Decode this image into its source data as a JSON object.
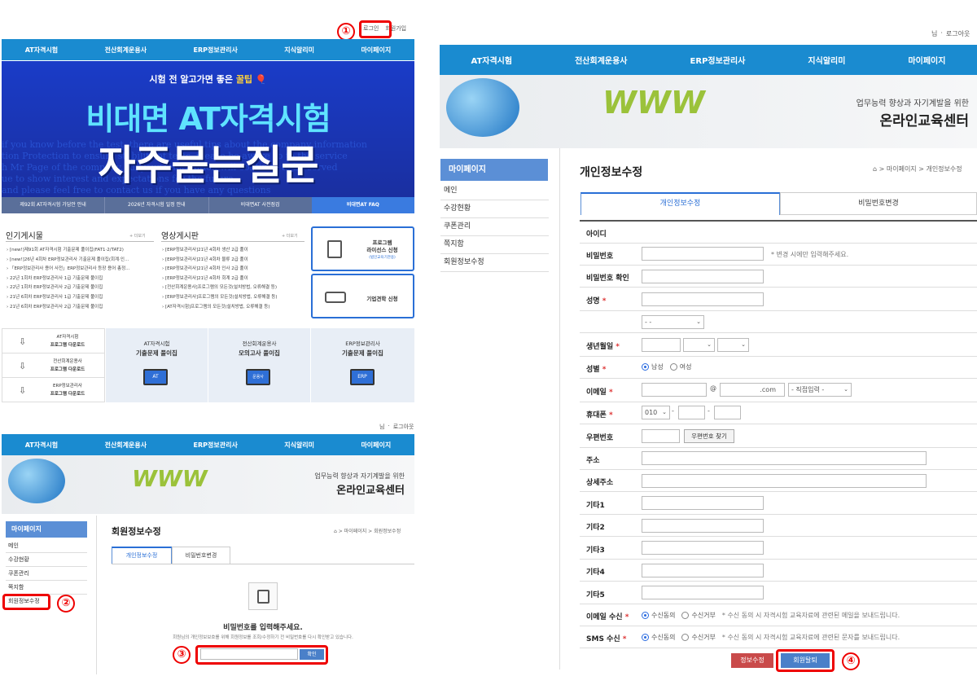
{
  "nav_items": [
    "AT자격시험",
    "전산회계운용사",
    "ERP정보관리사",
    "지식알리미",
    "마이페이지"
  ],
  "top_login": {
    "login": "로그인",
    "join": "회원가입"
  },
  "user_links": {
    "nim": "님",
    "logout": "로그아웃"
  },
  "step_numbers": [
    "①",
    "②",
    "③",
    "④"
  ],
  "banner": {
    "kicker": "시험 전 알고가면 좋은",
    "kicker_hl": "꿀팁",
    "title1": "비대면 AT자격시험",
    "title2": "자주묻는질문"
  },
  "banner_tabs": [
    "제92회 AT자격시험 가답안 안내",
    "2026년 자격시험 일정 안내",
    "비대면AT 사전점검",
    "비대면AT FAQ"
  ],
  "popular": {
    "title": "인기게시물",
    "more": "+ 더보기",
    "items": [
      "[new!]제91회 AT자격시험 기출문제 풀이집(FAT1·2/TAT2)",
      "[new!]26년 4회차 ERP정보관리사 기출문제 풀이집(회계·인...",
      "「ERP정보관리사 용어 사전」ERP정보관리사 등장 용어 총정...",
      "22년 1회차 ERP정보관리사 1급 기출문제 풀이집",
      "22년 1회차 ERP정보관리사 2급 기출문제 풀이집",
      "21년 6회차 ERP정보관리사 1급 기출문제 풀이집",
      "21년 6회차 ERP정보관리사 2급 기출문제 풀이집"
    ]
  },
  "video": {
    "title": "영상게시판",
    "more": "+ 더보기",
    "items": [
      "[ERP정보관리사]21년 4회차 생산 2급 풀이",
      "[ERP정보관리사]21년 4회차 물류 2급 풀이",
      "[ERP정보관리사]21년 4회차 인사 2급 풀이",
      "[ERP정보관리사]21년 4회차 회계 2급 풀이",
      "[전산회계운용사]프로그램의 모든것(설치방법, 오류해결 등)",
      "[ERP정보관리사]프로그램의 모든것(설치방법, 오류해결 등)",
      "[AT자격시험]프로그램의 모든것(설치방법, 오류해결 등)"
    ]
  },
  "side_cards": {
    "card1_title": "프로그램\n라이선스 신청",
    "card1_sub": "(법인교육기관용)",
    "card2_title": "기업견학 신청"
  },
  "downloads": [
    {
      "name": "AT자격시험",
      "label": "프로그램 다운로드"
    },
    {
      "name": "전산회계운용사",
      "label": "프로그램 다운로드"
    },
    {
      "name": "ERP정보관리사",
      "label": "프로그램 다운로드"
    }
  ],
  "books": [
    {
      "sub": "AT자격시험",
      "title": "기출문제 풀이집",
      "tag": "AT"
    },
    {
      "sub": "전산회계운용사",
      "title": "모의고사 풀이집",
      "tag": "운용사"
    },
    {
      "sub": "ERP정보관리사",
      "title": "기출문제 풀이집",
      "tag": "ERP"
    }
  ],
  "edu_banner": {
    "line1": "업무능력 향상과 자기계발을 위한",
    "line2": "온라인교육센터",
    "www": "WWW"
  },
  "mypage_side": {
    "title": "마이페이지",
    "items": [
      "메인",
      "수강현황",
      "쿠폰관리",
      "쪽지함",
      "회원정보수정"
    ]
  },
  "verify": {
    "page_title": "회원정보수정",
    "breadcrumb": "⌂ > 마이페이지 > 회원정보수정",
    "tabs": [
      "개인정보수정",
      "비밀번호변경"
    ],
    "heading": "비밀번호를 입력해주세요.",
    "desc": "회원님의 개인정보보호를 위해 회원정보를 조회/수정하기 전 비밀번호를 다시 확인받고 있습니다.",
    "confirm": "확인"
  },
  "form": {
    "page_title": "개인정보수정",
    "breadcrumb": "⌂ > 마이페이지 > 개인정보수정",
    "tabs": [
      "개인정보수정",
      "비밀번호변경"
    ],
    "labels": {
      "id": "아이디",
      "pw": "비밀번호",
      "pw_confirm": "비밀번호 확인",
      "name": "성명",
      "birth": "생년월일",
      "gender": "성별",
      "email": "이메일",
      "phone": "휴대폰",
      "zip": "우편번호",
      "addr": "주소",
      "addr2": "상세주소",
      "etc1": "기타1",
      "etc2": "기타2",
      "etc3": "기타3",
      "etc4": "기타4",
      "etc5": "기타5",
      "email_rcv": "이메일 수신",
      "sms_rcv": "SMS 수신"
    },
    "req_mark": "*",
    "pw_note": "* 변경 시에만 입력해주세요.",
    "select_blank": "- -",
    "gender_male": "남성",
    "gender_female": "여성",
    "at": "@",
    "email_domain": ".com",
    "email_select": "- 직접입력 -",
    "phone_prefix": "010",
    "dash": "-",
    "zip_button": "우편번호 찾기",
    "agree": "수신동의",
    "refuse": "수신거부",
    "email_note": "* 수신 동의 시 자격시험 교육자료에 관련된 메일을 보내드립니다.",
    "sms_note": "* 수신 동의 시 자격시험 교육자료에 관련된 문자를 보내드립니다.",
    "save": "정보수정",
    "withdraw": "회원탈퇴"
  },
  "colors": {
    "nav": "#1a8bd0",
    "banner": "#1b3fbf",
    "highlight": "#e00000",
    "side_title": "#5b8fd6"
  }
}
